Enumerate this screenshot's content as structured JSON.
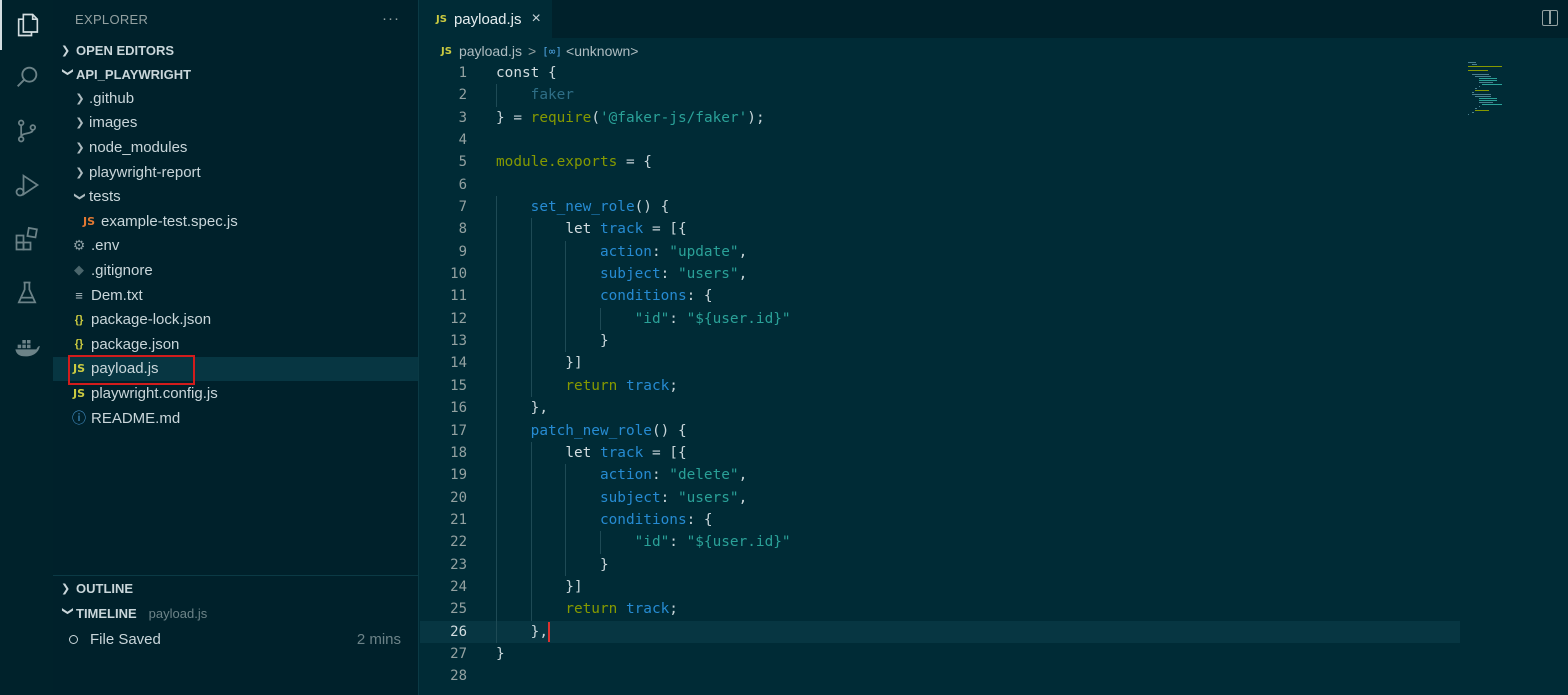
{
  "sidebar": {
    "title": "EXPLORER",
    "more": "···",
    "sections": {
      "open_editors": "OPEN EDITORS",
      "project": "API_PLAYWRIGHT"
    },
    "tree": [
      {
        "label": ".github",
        "type": "folder",
        "open": false
      },
      {
        "label": "images",
        "type": "folder",
        "open": false
      },
      {
        "label": "node_modules",
        "type": "folder",
        "open": false
      },
      {
        "label": "playwright-report",
        "type": "folder",
        "open": false
      },
      {
        "label": "tests",
        "type": "folder",
        "open": true
      },
      {
        "label": "example-test.spec.js",
        "type": "js-test",
        "icon": "JS"
      },
      {
        "label": ".env",
        "type": "env",
        "icon": "gear-icon"
      },
      {
        "label": ".gitignore",
        "type": "git",
        "icon": "diamond-icon"
      },
      {
        "label": "Dem.txt",
        "type": "txt",
        "icon": "lines-icon"
      },
      {
        "label": "package-lock.json",
        "type": "json",
        "icon": "{}"
      },
      {
        "label": "package.json",
        "type": "json",
        "icon": "{}"
      },
      {
        "label": "payload.js",
        "type": "js",
        "icon": "JS",
        "selected": true
      },
      {
        "label": "playwright.config.js",
        "type": "js",
        "icon": "JS"
      },
      {
        "label": "README.md",
        "type": "info",
        "icon": "info-icon"
      }
    ],
    "outline": "OUTLINE",
    "timeline": {
      "title": "TIMELINE",
      "file": "payload.js",
      "entry": "File Saved",
      "time": "2 mins"
    }
  },
  "editor": {
    "tab": {
      "icon": "JS",
      "label": "payload.js",
      "close": "×"
    },
    "breadcrumb": {
      "file": "payload.js",
      "symbol": "<unknown>"
    }
  },
  "code_lines": [
    "const {",
    "    faker",
    "} = require('@faker-js/faker');",
    "",
    "module.exports = {",
    "",
    "    set_new_role() {",
    "        let track = [{",
    "            action: \"update\",",
    "            subject: \"users\",",
    "            conditions: {",
    "                \"id\": \"${user.id}\"",
    "            }",
    "        }]",
    "        return track;",
    "    },",
    "    patch_new_role() {",
    "        let track = [{",
    "            action: \"delete\",",
    "            subject: \"users\",",
    "            conditions: {",
    "                \"id\": \"${user.id}\"",
    "            }",
    "        }]",
    "        return track;",
    "    },",
    "}",
    ""
  ],
  "colors": {
    "accent_red": "#d21c1c",
    "background": "#002b36",
    "sidebar": "#00212b"
  }
}
